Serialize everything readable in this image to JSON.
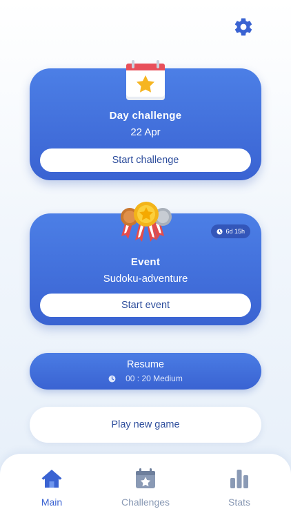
{
  "settings": {
    "icon": "gear-icon"
  },
  "day_challenge": {
    "title": "Day challenge",
    "date": "22 Apr",
    "button_label": "Start challenge"
  },
  "event": {
    "title": "Event",
    "name": "Sudoku-adventure",
    "time_left": "6d 15h",
    "button_label": "Start event"
  },
  "resume": {
    "label": "Resume",
    "time": "00 : 20",
    "difficulty": "Medium"
  },
  "new_game": {
    "label": "Play new game"
  },
  "tabs": [
    {
      "label": "Main",
      "icon": "home-icon",
      "active": true
    },
    {
      "label": "Challenges",
      "icon": "calendar-star-icon",
      "active": false
    },
    {
      "label": "Stats",
      "icon": "bar-chart-icon",
      "active": false
    }
  ],
  "colors": {
    "primary": "#3a63d2",
    "primary_light": "#4c7fe6",
    "button_text": "#2d4d9c",
    "inactive": "#8a9ab5"
  }
}
